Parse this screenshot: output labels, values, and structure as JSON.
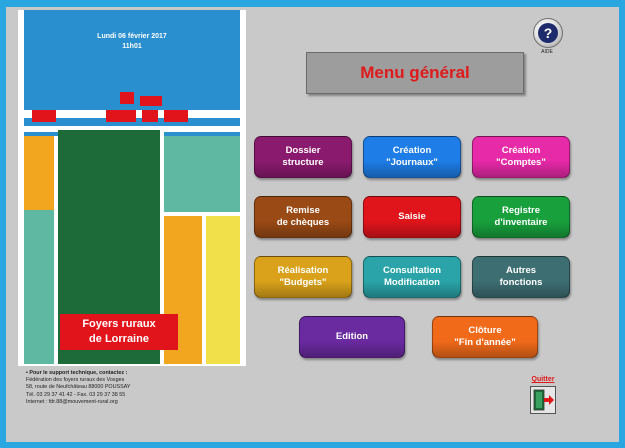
{
  "header": {
    "help_label": "AIDE",
    "help_glyph": "?",
    "menu_title": "Menu général"
  },
  "poster": {
    "date": "Lundi 06 février 2017",
    "time": "11h01",
    "title_line1": "Foyers ruraux",
    "title_line2": "de Lorraine",
    "colors": {
      "sky": "#2a8fcf",
      "red": "#e2141b",
      "green": "#1e6b3a",
      "teal": "#5fb8a2",
      "yellow": "#f1e04a",
      "orange": "#f2a51e"
    }
  },
  "support": {
    "heading": "• Pour le support technique, contactez :",
    "line1": "Fédération des foyers ruraux des Vosges",
    "line2": "58, route de Neufchâteau 88000 POUSSAY",
    "line3": "Tél. 03 29 37 41 42 - Fax. 03 29 37 38 55",
    "line4": "Internet : fdr.88@mouvement-rural.org"
  },
  "buttons": [
    {
      "id": "dossier-structure",
      "label": "Dossier\nstructure",
      "color": "#8a1a6e"
    },
    {
      "id": "creation-journaux",
      "label": "Création\n\"Journaux\"",
      "color": "#1e7de6"
    },
    {
      "id": "creation-comptes",
      "label": "Création\n\"Comptes\"",
      "color": "#e62aa8"
    },
    {
      "id": "remise-cheques",
      "label": "Remise\nde chèques",
      "color": "#9a4a14"
    },
    {
      "id": "saisie",
      "label": "Saisie",
      "color": "#e0141b"
    },
    {
      "id": "registre-inventaire",
      "label": "Registre\nd'inventaire",
      "color": "#18a03c"
    },
    {
      "id": "realisation-budgets",
      "label": "Réalisation\n\"Budgets\"",
      "color": "#d9a21a"
    },
    {
      "id": "consultation-modification",
      "label": "Consultation\nModification",
      "color": "#2aa4a8"
    },
    {
      "id": "autres-fonctions",
      "label": "Autres\nfonctions",
      "color": "#3d6e72"
    },
    {
      "id": "edition",
      "label": "Edition",
      "color": "#6a2aa0"
    },
    {
      "id": "cloture-fin-annee",
      "label": "Clôture\n\"Fin d'année\"",
      "color": "#f06a1a"
    }
  ],
  "quit": {
    "label": "Quitter",
    "icon": "exit-door-icon"
  }
}
